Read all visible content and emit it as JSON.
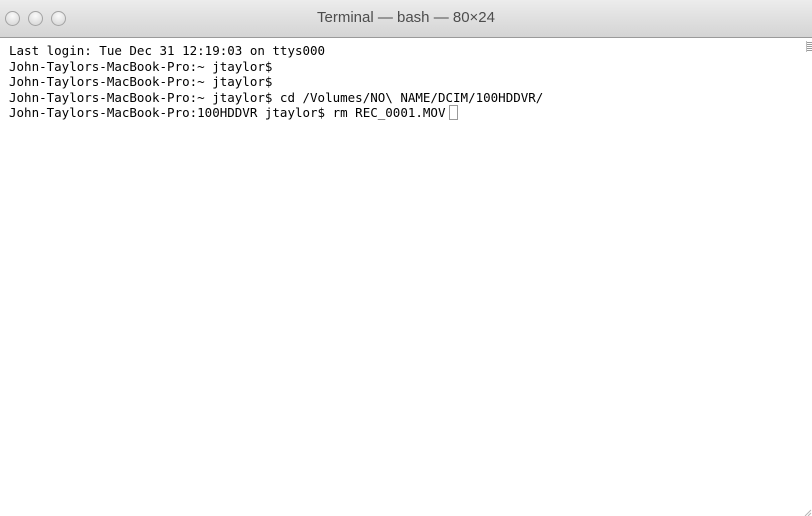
{
  "window": {
    "title": "Terminal — bash — 80×24"
  },
  "terminal": {
    "lines": [
      "Last login: Tue Dec 31 12:19:03 on ttys000",
      "John-Taylors-MacBook-Pro:~ jtaylor$",
      "John-Taylors-MacBook-Pro:~ jtaylor$",
      "John-Taylors-MacBook-Pro:~ jtaylor$ cd /Volumes/NO\\ NAME/DCIM/100HDDVR/",
      "John-Taylors-MacBook-Pro:100HDDVR jtaylor$ rm REC_0001.MOV"
    ]
  },
  "icons": {
    "close": "close-button",
    "minimize": "minimize-button",
    "zoom": "zoom-button",
    "split": "split-pane-icon",
    "resize": "resize-grip-icon"
  }
}
